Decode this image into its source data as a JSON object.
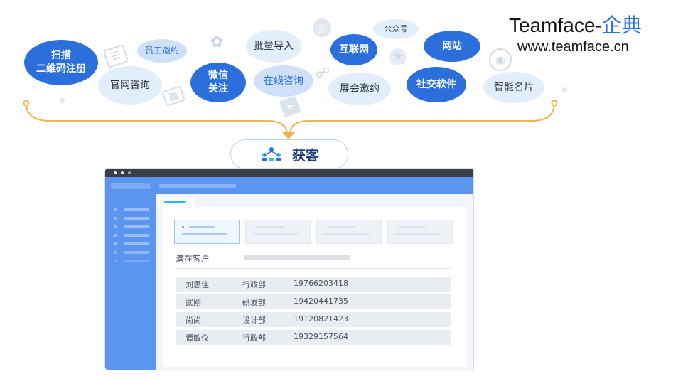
{
  "brand": {
    "name_en": "Teamface-",
    "name_cn": "企典",
    "website": "www.teamface.cn"
  },
  "channels": [
    {
      "label": "扫描\n二维码注册",
      "style": "dark"
    },
    {
      "label": "员工邀约",
      "style": "mid"
    },
    {
      "label": "官网咨询",
      "style": "light"
    },
    {
      "label": "微信\n关注",
      "style": "dark"
    },
    {
      "label": "批量导入",
      "style": "light"
    },
    {
      "label": "在线咨询",
      "style": "mid"
    },
    {
      "label": "互联网",
      "style": "dark"
    },
    {
      "label": "公众号",
      "style": "light"
    },
    {
      "label": "展会邀约",
      "style": "light"
    },
    {
      "label": "社交软件",
      "style": "dark"
    },
    {
      "label": "网站",
      "style": "dark"
    },
    {
      "label": "智能名片",
      "style": "light"
    }
  ],
  "center_label": "获客",
  "app": {
    "section_title": "潜在客户",
    "customers": [
      {
        "name": "刘思佳",
        "dept": "行政部",
        "phone": "19766203418"
      },
      {
        "name": "武刚",
        "dept": "研发部",
        "phone": "19420441735"
      },
      {
        "name": "尚尚",
        "dept": "设计部",
        "phone": "19120821423"
      },
      {
        "name": "谭敏仪",
        "dept": "行政部",
        "phone": "19329157564"
      }
    ]
  },
  "colors": {
    "accent": "#2a6fdc",
    "bubble_light": "#e3eefc",
    "connector": "#f1b44c",
    "app_blue": "#5b95f0"
  }
}
